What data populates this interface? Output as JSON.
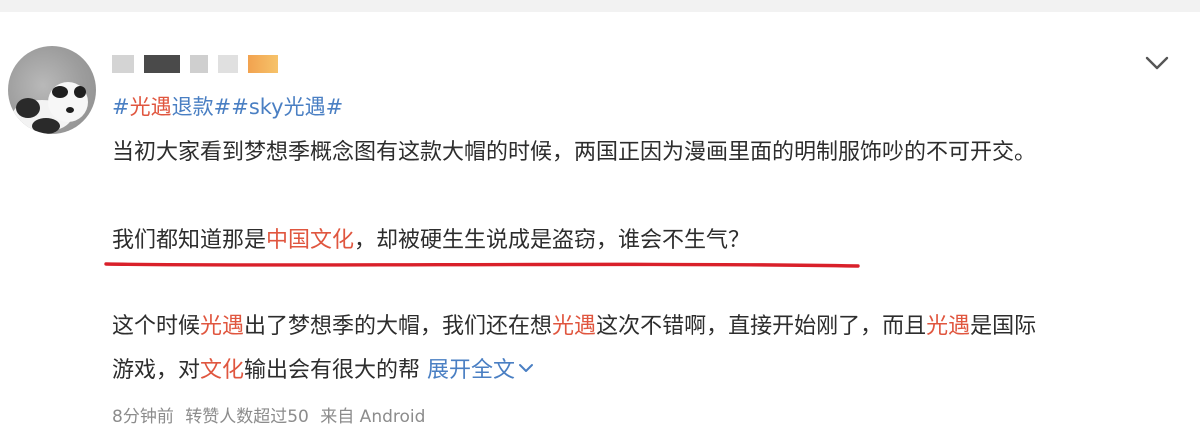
{
  "post": {
    "tags": {
      "hash1": "#",
      "name1": "光遇",
      "word1": "退款",
      "hash2": "##",
      "name2": "sky光遇",
      "hash3": "#"
    },
    "paragraph1": "当初大家看到梦想季概念图有这款大帽的时候，两国正因为漫画里面的明制服饰吵的不可开交。",
    "paragraph2": {
      "before": "我们都知道那是",
      "highlight": "中国文化",
      "after": "，却被硬生生说成是盗窃，谁会不生气？"
    },
    "paragraph3": {
      "t1": "这个时候",
      "h1": "光遇",
      "t2": "出了梦想季的大帽，我们还在想",
      "h2": "光遇",
      "t3": "这次不错啊，直接开始刚了，而且",
      "h3": "光遇",
      "t4": "是国际"
    },
    "paragraph4": {
      "t1": "游戏，对",
      "h1": "文化",
      "t2": "输出会有很大的帮",
      "expand": "展开全文"
    },
    "meta": {
      "time": "8分钟前",
      "reposts": "转赞人数超过50",
      "source": "来自 Android"
    }
  },
  "icons": {
    "menu": "chevron-down-icon",
    "expand": "chevron-down-icon"
  },
  "colors": {
    "link_blue": "#4a7fc3",
    "highlight_red": "#e0563f",
    "underline_red": "#d9202a",
    "meta_gray": "#8c8c8c"
  }
}
